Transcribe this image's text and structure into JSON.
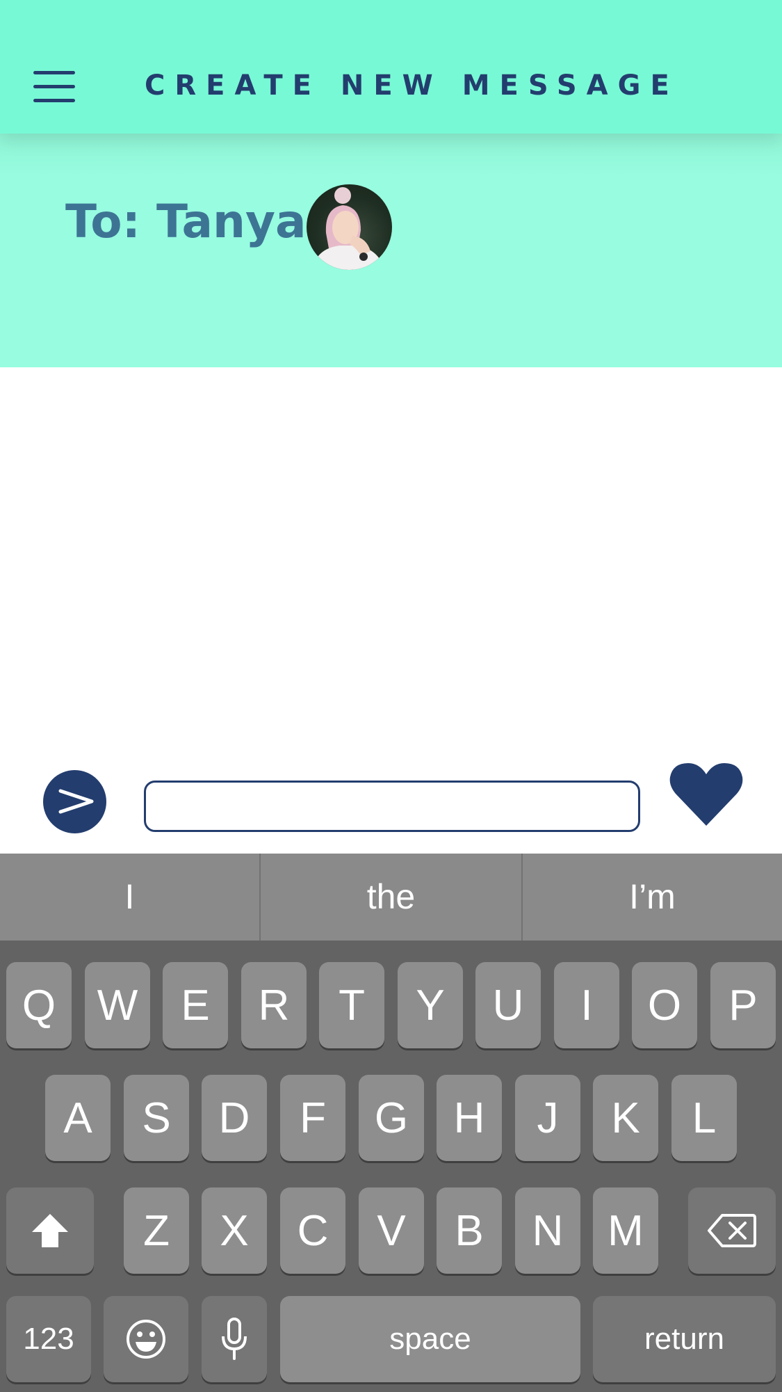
{
  "header": {
    "title": "CREATE NEW MESSAGE",
    "menu_icon": "hamburger-menu-icon",
    "background": "#78f9d5",
    "text_color": "#233d6e"
  },
  "recipient": {
    "label": "To: Tanya",
    "label_color": "#3d7494",
    "avatar": "profile-photo"
  },
  "composer": {
    "input_value": "",
    "send_icon": "send-arrow-icon",
    "like_icon": "heart-icon",
    "accent": "#233d6e"
  },
  "keyboard": {
    "suggestions": [
      "I",
      "the",
      "I’m"
    ],
    "row1": [
      "Q",
      "W",
      "E",
      "R",
      "T",
      "Y",
      "U",
      "I",
      "O",
      "P"
    ],
    "row2": [
      "A",
      "S",
      "D",
      "F",
      "G",
      "H",
      "J",
      "K",
      "L"
    ],
    "row3": [
      "Z",
      "X",
      "C",
      "V",
      "B",
      "N",
      "M"
    ],
    "shift_icon": "shift-arrow-icon",
    "delete_icon": "backspace-icon",
    "numbers_label": "123",
    "emoji_icon": "emoji-icon",
    "mic_icon": "microphone-icon",
    "space_label": "space",
    "return_label": "return"
  }
}
